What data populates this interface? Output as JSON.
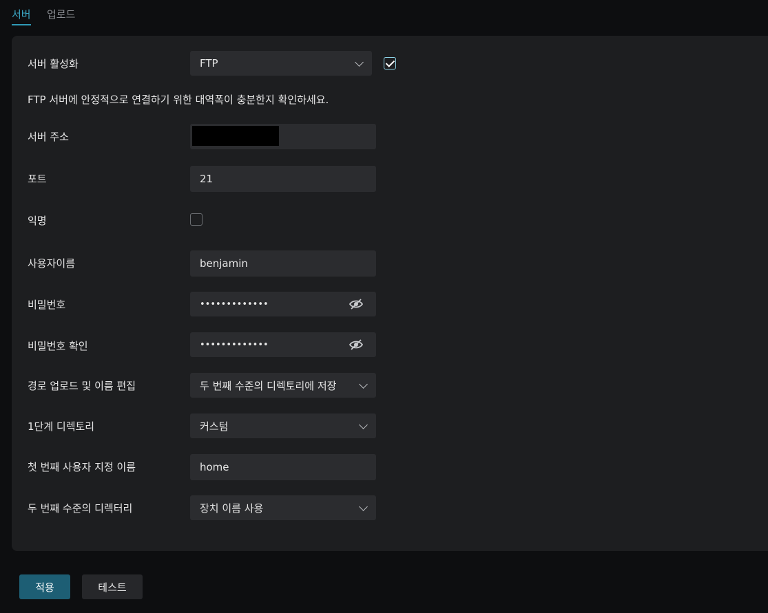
{
  "tabs": {
    "server": "서버",
    "upload": "업로드"
  },
  "form": {
    "server_enable": {
      "label": "서버 활성화",
      "value": "FTP",
      "checked": true
    },
    "info": "FTP 서버에 안정적으로 연결하기 위한 대역폭이 충분한지 확인하세요.",
    "server_address": {
      "label": "서버 주소",
      "value": ""
    },
    "port": {
      "label": "포트",
      "value": "21"
    },
    "anonymous": {
      "label": "익명",
      "checked": false
    },
    "username": {
      "label": "사용자이름",
      "value": "benjamin"
    },
    "password": {
      "label": "비밀번호",
      "value": "•••••••••••••"
    },
    "password_confirm": {
      "label": "비밀번호 확인",
      "value": "•••••••••••••"
    },
    "path_edit": {
      "label": "경로 업로드 및 이름 편집",
      "value": "두 번째 수준의 디렉토리에 저장"
    },
    "first_level_dir": {
      "label": "1단계 디렉토리",
      "value": "커스텀"
    },
    "first_custom_name": {
      "label": "첫 번째 사용자 지정 이름",
      "value": "home"
    },
    "second_level_dir": {
      "label": "두 번째 수준의 디렉터리",
      "value": "장치 이름 사용"
    }
  },
  "buttons": {
    "apply": "적용",
    "test": "테스트"
  },
  "icons": {
    "chevron": "chevron-down-icon",
    "eye": "eye-off-icon",
    "check": "check-icon"
  },
  "colors": {
    "accent": "#2f9ab7",
    "apply_bg": "#1d5e74",
    "panel": "#1d1e20"
  }
}
